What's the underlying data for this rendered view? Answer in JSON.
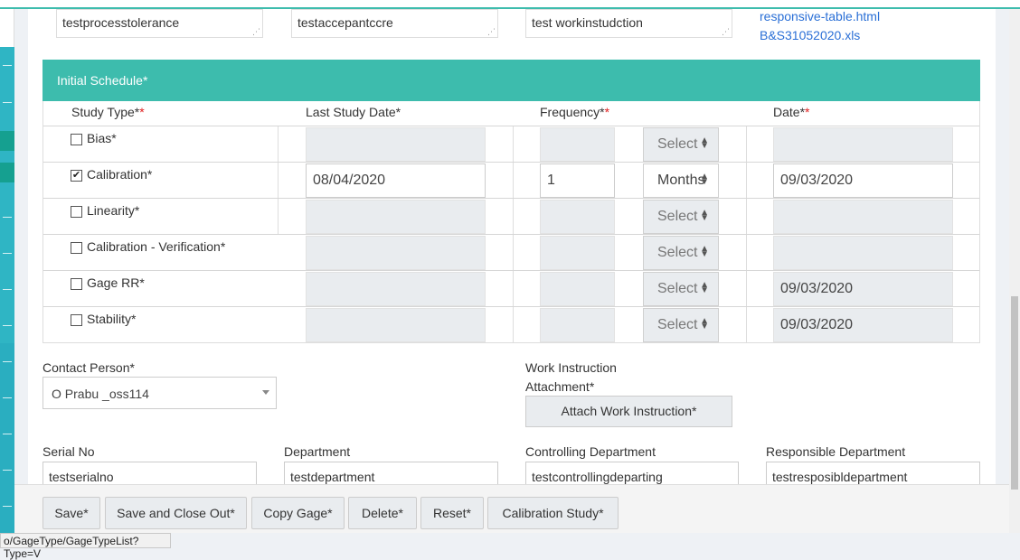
{
  "top_fields": {
    "process_tolerance": "testprocesstolerance",
    "acceptance_criteria": "testaccepantccre",
    "work_instruction": "test workinstudction",
    "attachments": [
      "responsive-table.html",
      "B&S31052020.xls"
    ]
  },
  "schedule": {
    "title": "Initial Schedule*",
    "headers": {
      "study_type": "Study Type*",
      "last_study_date": "Last Study Date*",
      "frequency": "Frequency*",
      "date": "Date*"
    },
    "required_mark": "*",
    "rows": [
      {
        "label": "Bias*",
        "checked": false,
        "last_date": "",
        "frequency": "",
        "unit": "Select",
        "date": ""
      },
      {
        "label": "Calibration*",
        "checked": true,
        "last_date": "08/04/2020",
        "frequency": "1",
        "unit": "Months",
        "date": "09/03/2020"
      },
      {
        "label": "Linearity*",
        "checked": false,
        "last_date": "",
        "frequency": "",
        "unit": "Select",
        "date": ""
      },
      {
        "label": "Calibration - Verification*",
        "checked": false,
        "last_date": "",
        "frequency": "",
        "unit": "Select",
        "date": ""
      },
      {
        "label": "Gage RR*",
        "checked": false,
        "last_date": "",
        "frequency": "",
        "unit": "Select",
        "date": "09/03/2020"
      },
      {
        "label": "Stability*",
        "checked": false,
        "last_date": "",
        "frequency": "",
        "unit": "Select",
        "date": "09/03/2020"
      }
    ]
  },
  "contact": {
    "label": "Contact Person*",
    "value": "O Prabu _oss114"
  },
  "work_instruction_attachment": {
    "label_line1": "Work Instruction",
    "label_line2": "Attachment*",
    "button": "Attach Work Instruction*"
  },
  "details": {
    "serial_no": {
      "label": "Serial No",
      "value": "testserialno"
    },
    "department": {
      "label": "Department",
      "value": "testdepartment"
    },
    "controlling_department": {
      "label": "Controlling Department",
      "value": "testcontrollingdeparting"
    },
    "responsible_department": {
      "label": "Responsible Department",
      "value": "testresposibldepartment"
    }
  },
  "actions": {
    "save": "Save*",
    "save_close": "Save and Close Out*",
    "copy": "Copy Gage*",
    "delete": "Delete*",
    "reset": "Reset*",
    "calibration_study": "Calibration Study*"
  },
  "status_url": "o/GageType/GageTypeList?Type=V",
  "colors": {
    "panel_header": "#3dbcad",
    "required": "#e02020",
    "link": "#2a6fd6"
  },
  "icons": {
    "checkbox_checked": "✔",
    "select_arrows": "▲▼"
  }
}
